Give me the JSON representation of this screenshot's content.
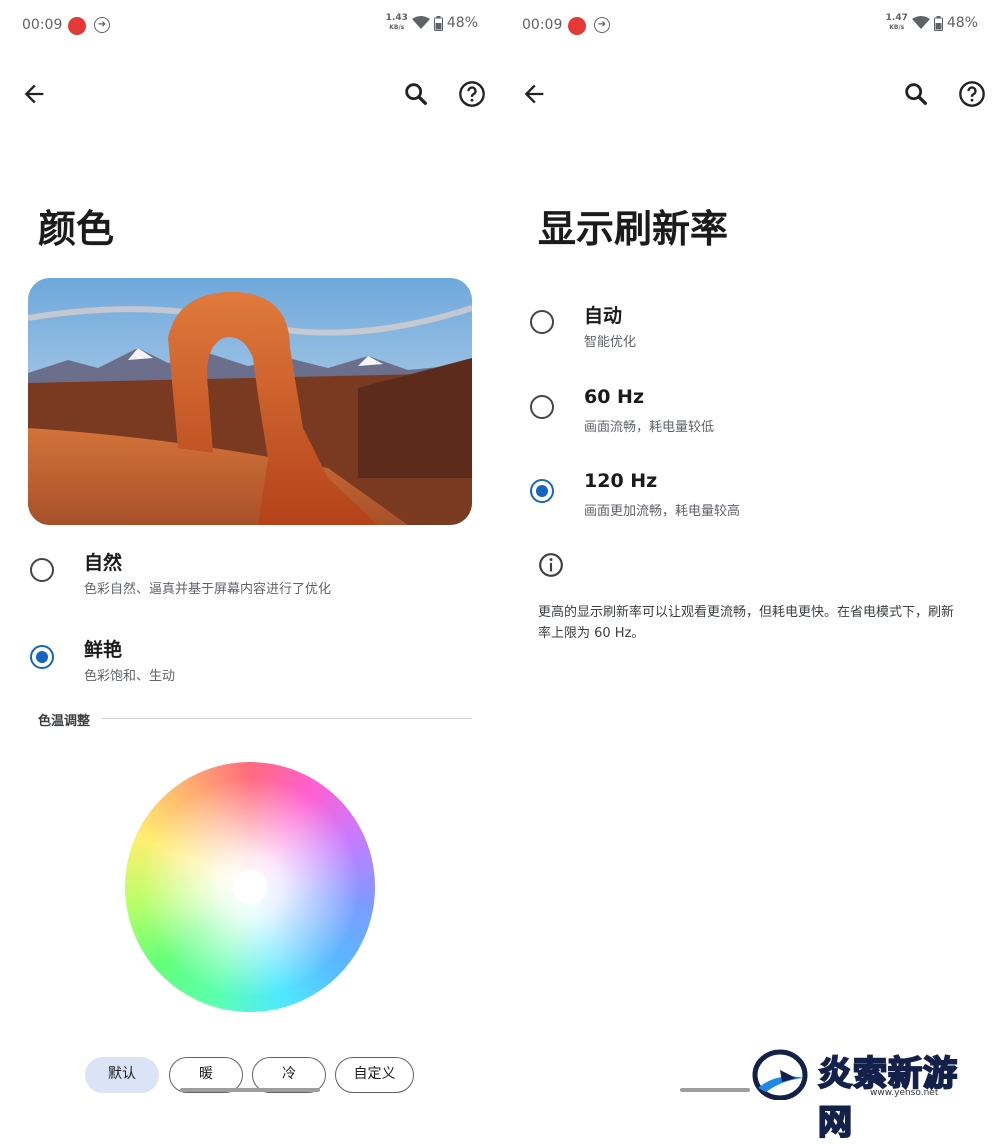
{
  "status_left": {
    "time": "00:09",
    "net_speed": "1.43",
    "net_unit": "KB/s",
    "battery": "48%"
  },
  "status_right": {
    "time": "00:09",
    "net_speed": "1.47",
    "net_unit": "KB/s",
    "battery": "48%"
  },
  "icons": {
    "back": "arrow-left-icon",
    "search": "search-icon",
    "help": "help-icon",
    "info": "info-icon"
  },
  "colors": {
    "accent": "#1565c0",
    "chip_selected_bg": "#dbe4f6"
  },
  "color_page": {
    "title": "颜色",
    "options": [
      {
        "label": "自然",
        "description": "色彩自然、逼真并基于屏幕内容进行了优化",
        "selected": false
      },
      {
        "label": "鲜艳",
        "description": "色彩饱和、生动",
        "selected": true
      }
    ],
    "section_title": "色温调整",
    "chips": [
      {
        "label": "默认",
        "selected": true
      },
      {
        "label": "暖",
        "selected": false
      },
      {
        "label": "冷",
        "selected": false
      },
      {
        "label": "自定义",
        "selected": false
      }
    ]
  },
  "refresh_page": {
    "title": "显示刷新率",
    "options": [
      {
        "label": "自动",
        "description": "智能优化",
        "selected": false
      },
      {
        "label": "60 Hz",
        "description": "画面流畅，耗电量较低",
        "selected": false
      },
      {
        "label": "120 Hz",
        "description": "画面更加流畅，耗电量较高",
        "selected": true
      }
    ],
    "note": "更高的显示刷新率可以让观看更流畅，但耗电更快。在省电模式下，刷新率上限为 60 Hz。"
  },
  "watermark": {
    "text": "炎索新游网",
    "url": "www.yenso.net"
  }
}
